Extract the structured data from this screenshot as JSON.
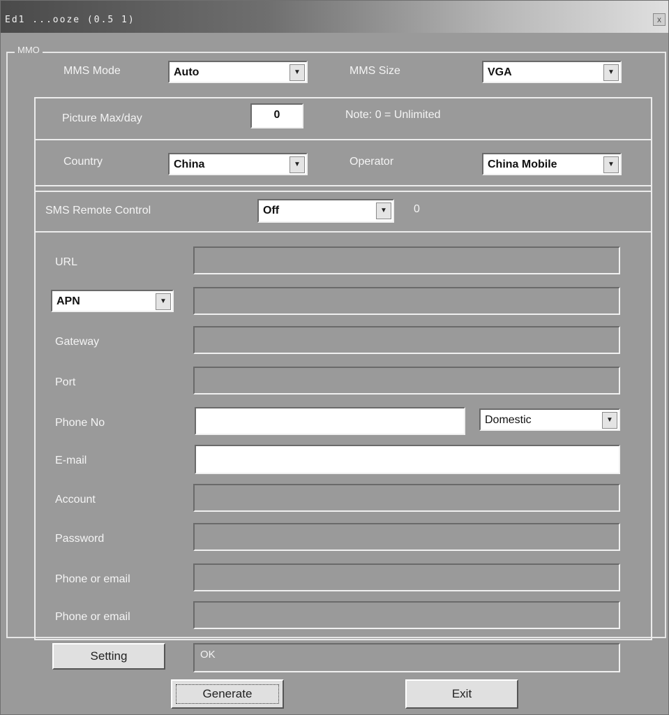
{
  "window": {
    "title": "Ed1 ...ooze (0.5 1)",
    "close_label": "x"
  },
  "group": {
    "legend": "MMO"
  },
  "row_mode": {
    "mode_label": "MMS Mode",
    "mode_value": "Auto",
    "size_label": "MMS Size",
    "size_value": "VGA"
  },
  "row_picture": {
    "label": "Picture Max/day",
    "value": "0",
    "note": "Note: 0 = Unlimited"
  },
  "row_country": {
    "country_label": "Country",
    "country_value": "China",
    "operator_label": "Operator",
    "operator_value": "China Mobile"
  },
  "row_sms": {
    "label": "SMS Remote Control",
    "value": "Off",
    "extra": "0"
  },
  "fields": {
    "url_label": "URL",
    "apn_value": "APN",
    "gateway_label": "Gateway",
    "port_label": "Port",
    "phone_label": "Phone No",
    "phone_type_value": "Domestic",
    "email_label": "E-mail",
    "account_label": "Account",
    "password_label": "Password",
    "phone_email_1_label": "Phone or email",
    "phone_email_2_label": "Phone or email"
  },
  "footer": {
    "setting_label": "Setting",
    "status_value": "OK",
    "generate_label": "Generate",
    "exit_label": "Exit"
  }
}
